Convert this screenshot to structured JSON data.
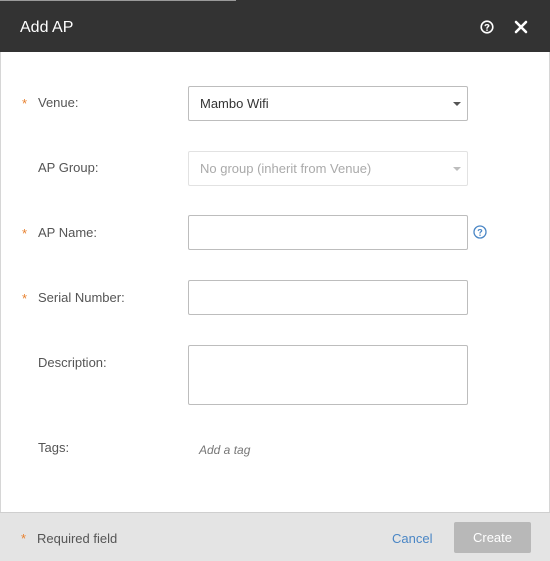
{
  "dialog": {
    "title": "Add AP"
  },
  "form": {
    "required_marker": "*",
    "venue": {
      "label": "Venue:",
      "value": "Mambo Wifi",
      "required": true
    },
    "ap_group": {
      "label": "AP Group:",
      "placeholder": "No group (inherit from Venue)",
      "disabled": true
    },
    "ap_name": {
      "label": "AP Name:",
      "value": "",
      "required": true
    },
    "serial_number": {
      "label": "Serial Number:",
      "value": "",
      "required": true
    },
    "description": {
      "label": "Description:",
      "value": ""
    },
    "tags": {
      "label": "Tags:",
      "placeholder": "Add a tag"
    }
  },
  "footer": {
    "required_note": "Required field",
    "cancel_label": "Cancel",
    "create_label": "Create"
  },
  "colors": {
    "header_bg": "#333333",
    "required_star": "#e8812f",
    "link": "#4a86c5",
    "help_icon": "#4a86c5",
    "disabled_button": "#b8b8b8"
  },
  "icons": [
    "help-icon",
    "close-icon",
    "dropdown-caret-icon",
    "field-help-icon"
  ]
}
